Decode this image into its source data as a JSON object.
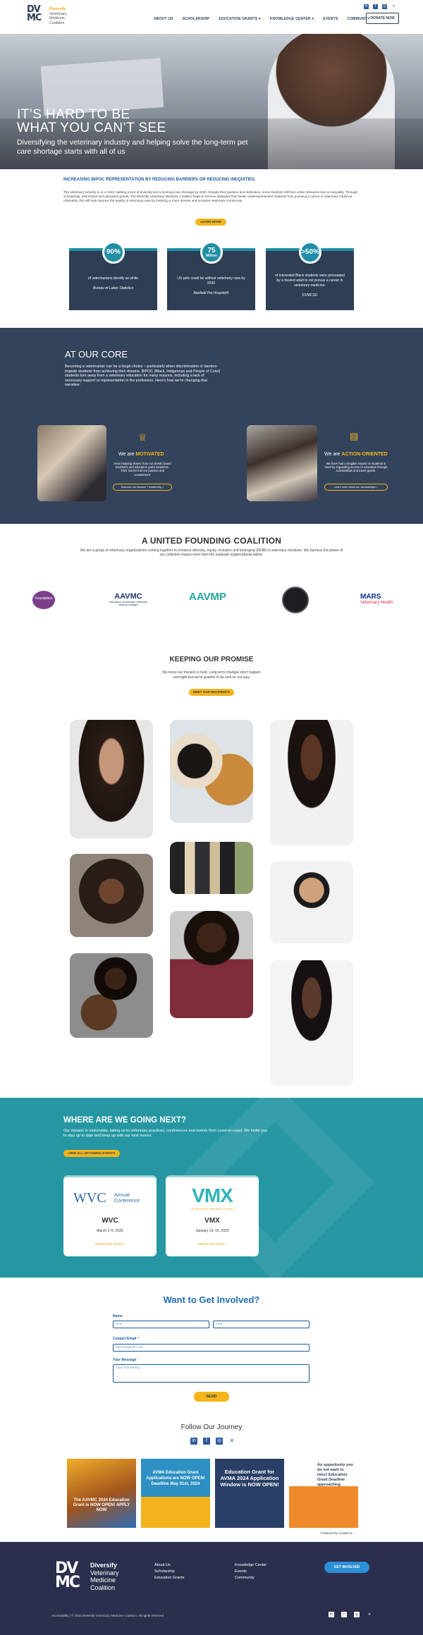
{
  "header": {
    "logo_mark": "DV\nMC",
    "logo_line1": "Diversify",
    "logo_line2": "Veterinary",
    "logo_line3": "Medicine",
    "logo_line4": "Coalition",
    "nav": [
      "ABOUT US",
      "SCHOLARSHIP",
      "EDUCATION GRANTS ▾",
      "KNOWLEDGE CENTER ▾",
      "EVENTS",
      "COMMUNITY"
    ],
    "donate": "DONATE NOW"
  },
  "hero": {
    "title_line1": "IT’S HARD TO BE",
    "title_line2": "WHAT YOU CAN’T SEE",
    "subtitle": "Diversifying the veterinary industry and helping solve the long-term pet care shortage starts with all of us"
  },
  "barriers": {
    "heading": "INCREASING BIPOC REPRESENTATION BY REDUCING BARRIERS OR REDUCING INEQUITIES.",
    "body": "The veterinary industry is in a crisis, battling a lack of diversity and a looming care shortage by 2030. Despite their passion and dedication, some students still face unfair obstacles due to inequality. Through scholarship, internships and education grants, The Diversify Veterinary Medicine Coalition helps to remove obstacles that hinder underrepresented students from pursuing a career in veterinary medicine. Ultimately, this will help improve the quality of veterinary care by fostering a more diverse and inclusive veterinary community.",
    "learn_more": "LEARN MORE",
    "stats": [
      {
        "value": "90%",
        "sub": "",
        "text": "of veterinarians identify as white",
        "source": "Bureau of Labor Statistics"
      },
      {
        "value": "75",
        "sub": "Million",
        "text": "US pets could be without veterinary care by 2030",
        "source": "Banfield Pet Hospital®"
      },
      {
        "value": ">50%",
        "sub": "",
        "text": "of interested Black students were persuaded by a trusted adult to not pursue a career in veterinary medicine.",
        "source": "DVMCSD"
      }
    ]
  },
  "core": {
    "title": "AT OUR CORE",
    "body": "Becoming a veterinarian can be a tough choice – particularly when discrimination or barriers impede students from achieving their dreams. BIPOC (Black, Indigenous and People of Color) students turn away from a veterinary education for many reasons, including a lack of necessary support or representation in the profession. Here’s how we’re changing that narrative:",
    "motivated_pre": "We are ",
    "motivated": "MOTIVATED",
    "motivated_desc": "Hear inspiring stories from our DVMC board members and education grant recipients. Their stories fuel our passion and commitment.",
    "motivated_btn": "Discover our mission + leadership >",
    "action_pre": "We are ",
    "action": "ACTION-ORIENTED",
    "action_desc": "We have had a tangible impact on students in need by expanding access to education through scholarships and travel grants.",
    "action_btn": "Learn more about our scholarships >"
  },
  "coalition": {
    "title": "A UNITED FOUNDING COALITION",
    "body": "We are a group of veterinary organizations coming together to enhance diversity, equity, inclusion and belonging (DEIB) in veterinary medicine. We harness the power of our collective impact more than the separate organizational labels.",
    "logos": [
      "Foundation",
      "AAVMC",
      "AAVMP",
      "",
      "MARS"
    ],
    "aavmc_sub": "Association of American Veterinary Medical Colleges",
    "mars_sub": "Veterinary Health"
  },
  "promise": {
    "title": "KEEPING OUR PROMISE",
    "body": "We know our mission is bold. Long-term changes don’t happen overnight but we’re grateful to be well on our way.",
    "button": "MEET OUR RECIPIENTS"
  },
  "next": {
    "title": "WHERE ARE WE GOING NEXT?",
    "body": "Our mission is nationwide, taking us to veterinary practices, conferences and events from coast-to-coast. We invite you to stay up to date and keep up with our next moves.",
    "button": "VIEW ALL UPCOMING EVENTS",
    "events": [
      {
        "logo": "WVC",
        "logo_sub": "Annual Conference",
        "name": "WVC",
        "date": "March 2–5, 2025",
        "cta": "REGISTER NOW >"
      },
      {
        "logo": "VMX",
        "logo_sub": "VETERINARY MEETING & EXPO",
        "name": "VMX",
        "date": "January 13–15, 2025",
        "cta": "REGISTER NOW >"
      }
    ]
  },
  "form": {
    "title": "Want to Get Involved?",
    "name_label": "Name",
    "first_ph": "First",
    "last_ph": "Last",
    "email_label": "Contact Email *",
    "email_ph": "name@gmail.com",
    "msg_label": "Your Message",
    "msg_ph": "Type something...",
    "send": "SEND"
  },
  "follow": {
    "title": "Follow Our Journey",
    "powered": "Powered by Curator.io",
    "posts": [
      "The AAVMC 2024 Education Grant is NOW OPEN! APPLY NOW",
      "AVMA Education Grant Applications are NOW OPEN! Deadline May 31st, 2024",
      "Education Grant for AVMA 2024 Application Window is NOW OPEN!",
      "An opportunity you do not want to miss! Education Grant Deadline approaching"
    ]
  },
  "footer": {
    "col1": [
      "About Us",
      "Scholarship",
      "Education Grants"
    ],
    "col2": [
      "Knowledge Center",
      "Events",
      "Community"
    ],
    "cta": "GET INVOLVED",
    "copyright": "Accessibility | © 2024 Diversify Veterinary Medicine Coalition. All rights reserved."
  }
}
